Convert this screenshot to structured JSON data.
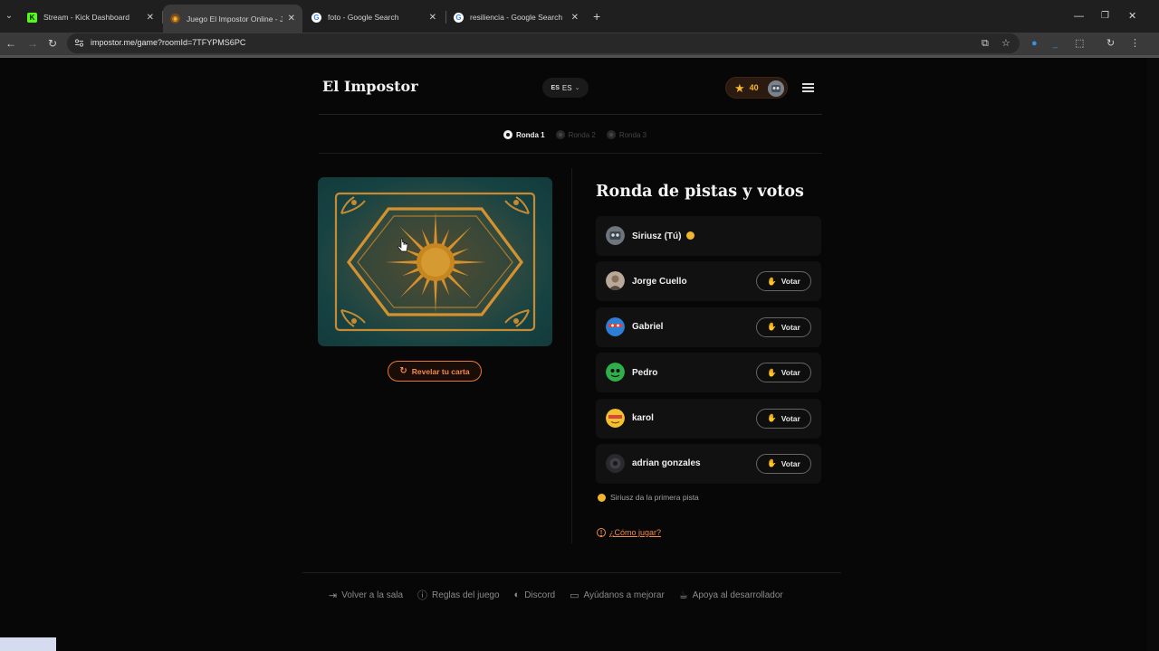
{
  "browser": {
    "tabs": [
      {
        "title": "Stream - Kick Dashboard",
        "favicon": "kick-icon",
        "active": false
      },
      {
        "title": "Juego El Impostor Online - Jug",
        "favicon": "impostor-icon",
        "active": true
      },
      {
        "title": "foto - Google Search",
        "favicon": "google-icon",
        "active": false
      },
      {
        "title": "resiliencia - Google Search",
        "favicon": "google-icon",
        "active": false
      }
    ],
    "url": "impostor.me/game?roomId=7TFYPMS6PC"
  },
  "header": {
    "brand": "El Impostor",
    "lang_flag": "ES",
    "lang_code": "ES",
    "points": "40"
  },
  "rounds": [
    {
      "label": "Ronda 1",
      "state": "current"
    },
    {
      "label": "Ronda 2",
      "state": "upcoming"
    },
    {
      "label": "Ronda 3",
      "state": "upcoming"
    }
  ],
  "card": {
    "reveal_label": "Revelar tu carta",
    "colors": {
      "ink": "#d4912f",
      "base": "#1b4a48",
      "accent": "#e8773a"
    }
  },
  "main": {
    "title": "Ronda de pistas y votos",
    "vote_label": "Votar",
    "players": [
      {
        "name": "Siriusz (Tú)",
        "is_self": true,
        "has_turn": true
      },
      {
        "name": "Jorge Cuello",
        "is_self": false
      },
      {
        "name": "Gabriel",
        "is_self": false
      },
      {
        "name": "Pedro",
        "is_self": false
      },
      {
        "name": "karol",
        "is_self": false
      },
      {
        "name": "adrian gonzales",
        "is_self": false
      }
    ],
    "turn_hint": "Siriusz da la primera pista",
    "howto": "¿Cómo jugar?"
  },
  "footer": {
    "items": [
      {
        "label": "Volver a la sala",
        "icon": "exit-icon"
      },
      {
        "label": "Reglas del juego",
        "icon": "info-icon"
      },
      {
        "label": "Discord",
        "icon": "discord-icon"
      },
      {
        "label": "Ayúdanos a mejorar",
        "icon": "feedback-icon"
      },
      {
        "label": "Apoya al desarrollador",
        "icon": "coffee-icon"
      }
    ]
  }
}
